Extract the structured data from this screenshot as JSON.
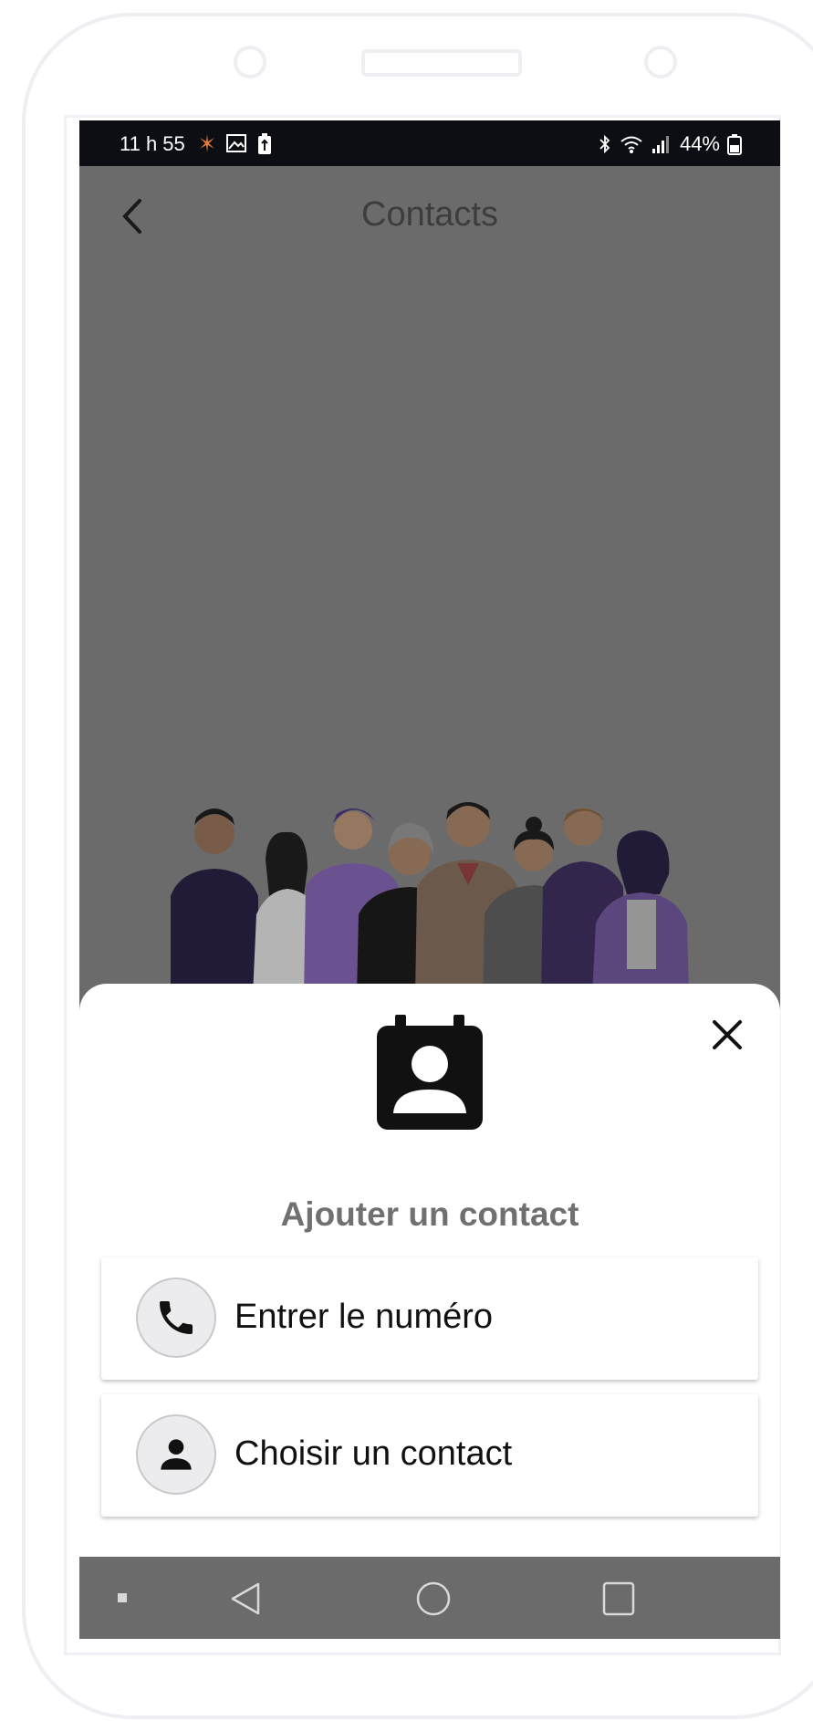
{
  "status_bar": {
    "time": "11 h 55",
    "battery": "44%"
  },
  "app_bar": {
    "title": "Contacts",
    "back_icon": "chevron-left-icon"
  },
  "sheet": {
    "title": "Ajouter un contact",
    "header_icon": "contact-book-icon",
    "close_icon": "close-icon",
    "options": [
      {
        "label": "Entrer le numéro",
        "icon": "phone-icon"
      },
      {
        "label": "Choisir un contact",
        "icon": "person-icon"
      }
    ]
  },
  "colors": {
    "scrim": "#6b6b6b",
    "status_bar": "#0c0e13",
    "sheet_bg": "#ffffff",
    "sheet_title": "#707070",
    "accent_purple": "#7b5aa6"
  }
}
